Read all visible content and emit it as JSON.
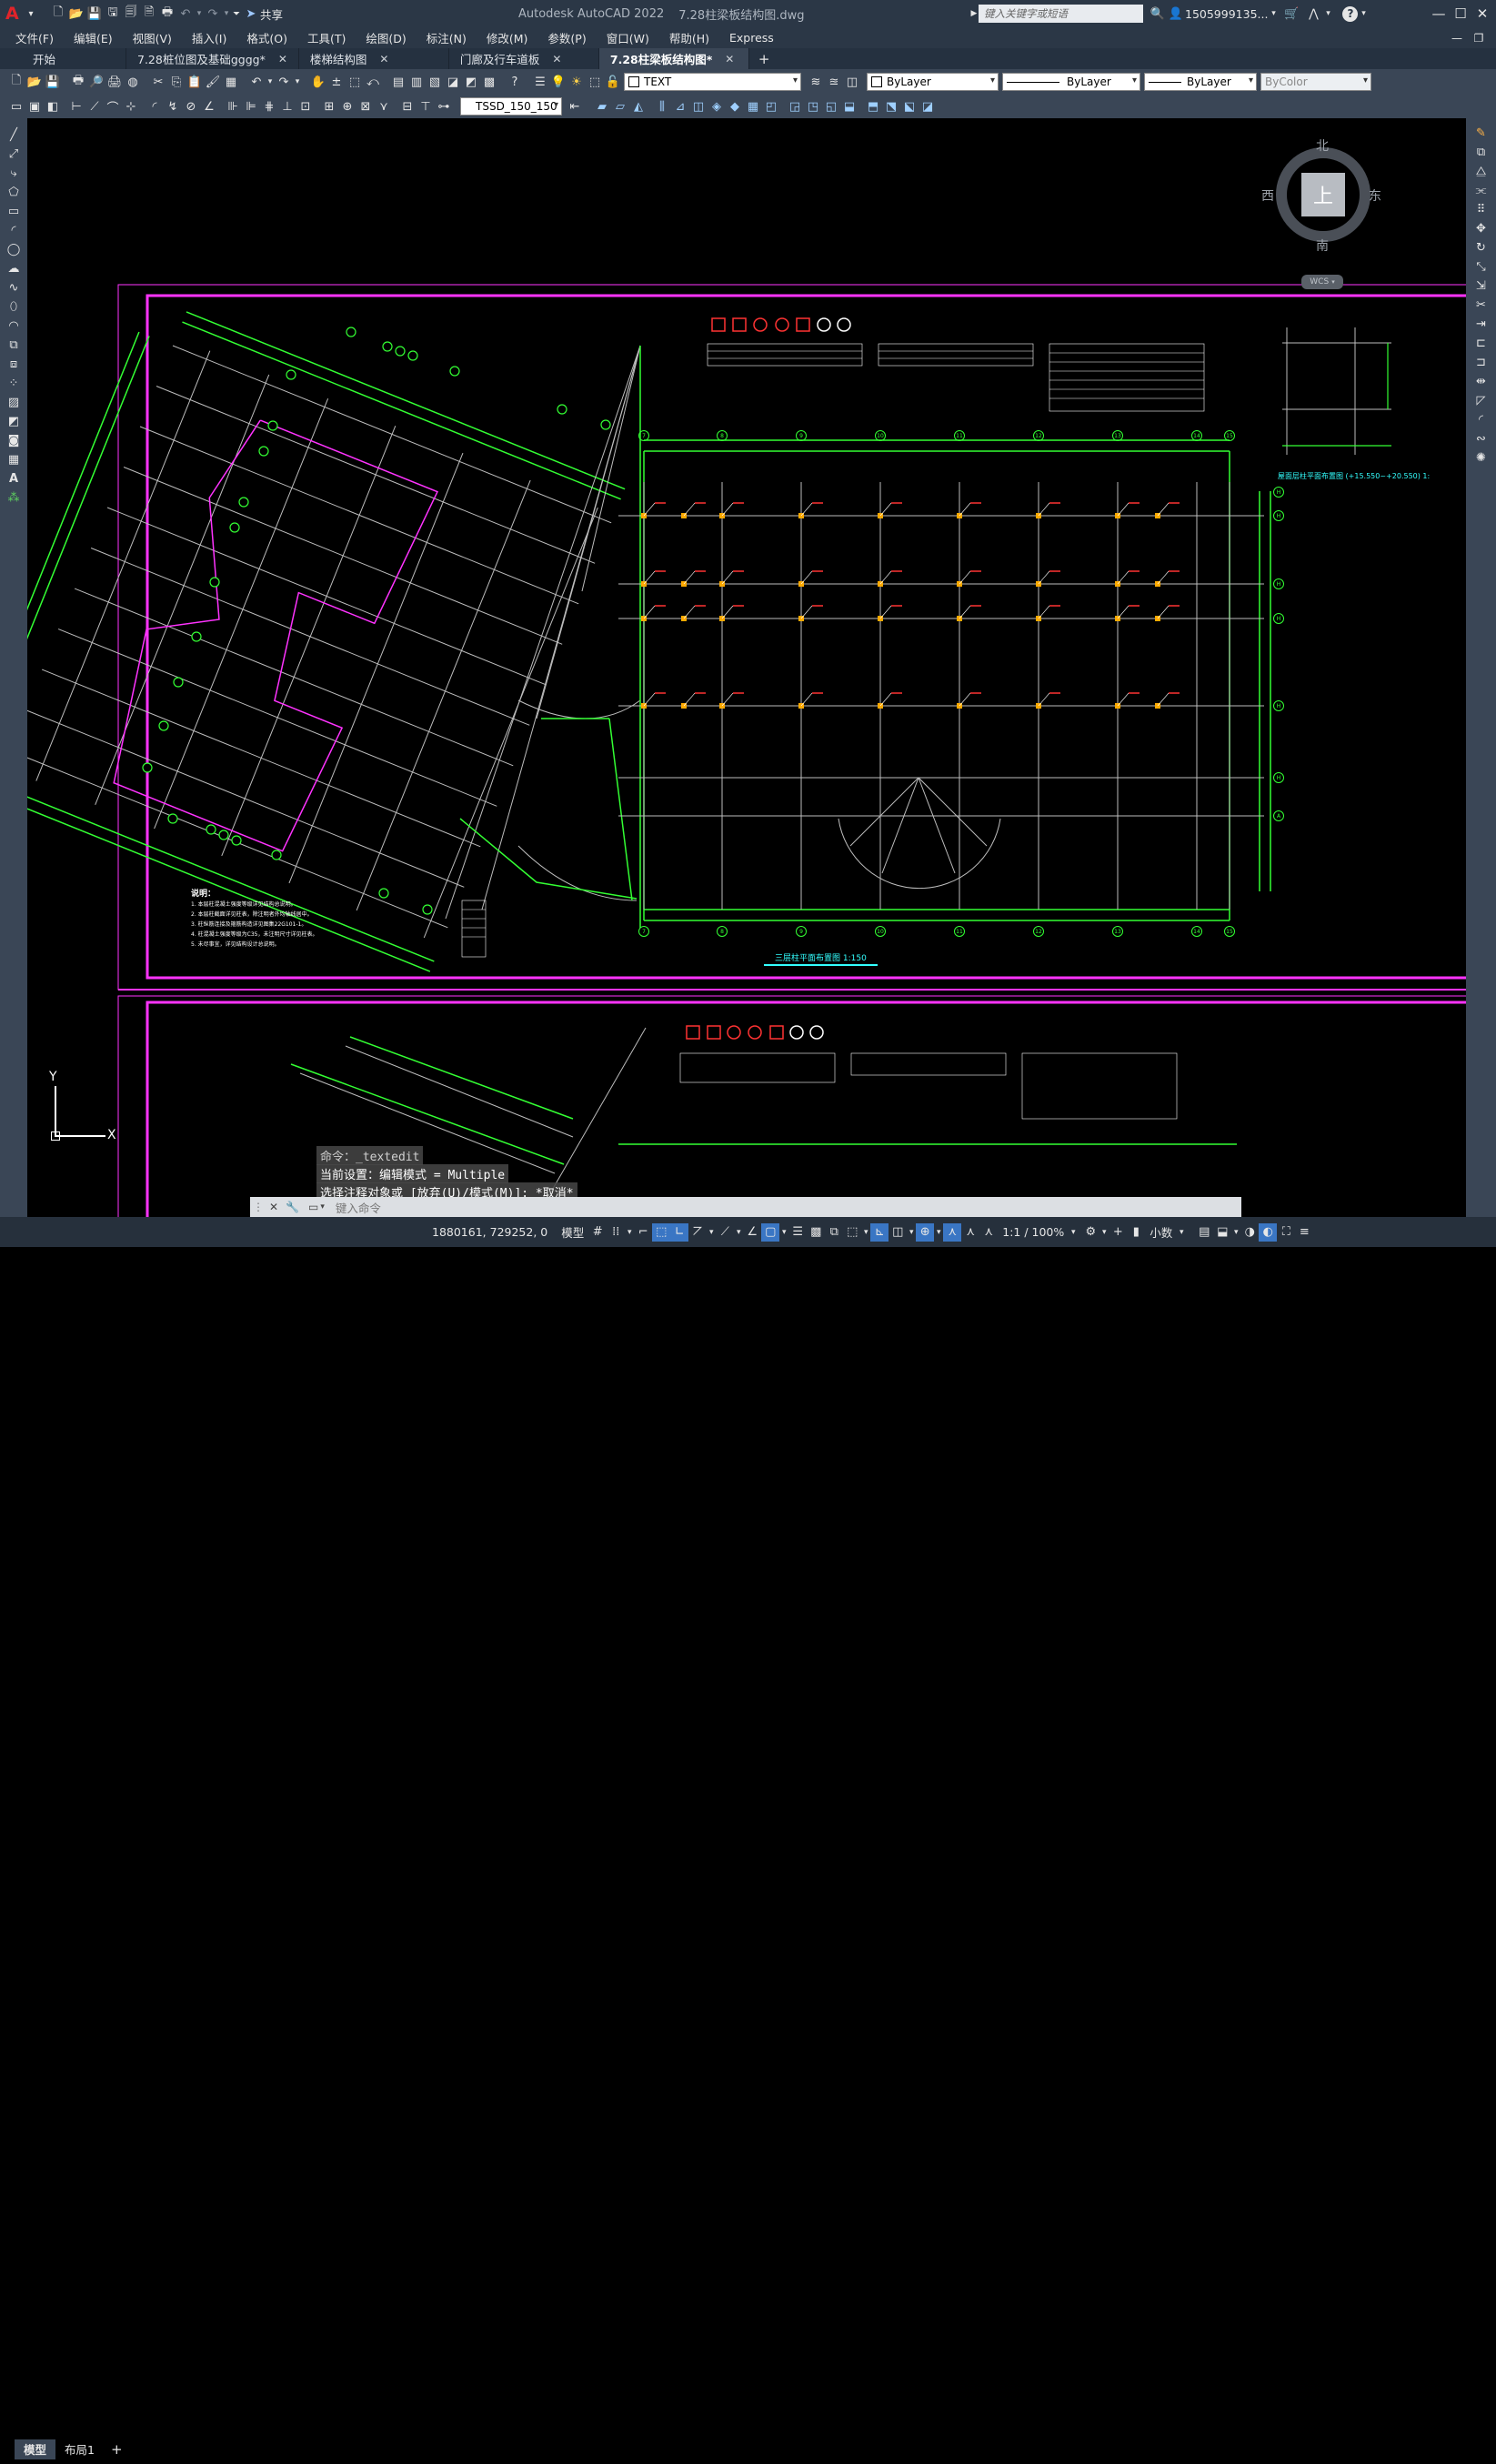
{
  "app": {
    "logo": "A",
    "title": "Autodesk AutoCAD 2022",
    "filename": "7.28柱梁板结构图.dwg",
    "share_label": "共享",
    "search_placeholder": "键入关键字或短语",
    "user": "1505999135...",
    "help": "?"
  },
  "menu": [
    "文件(F)",
    "编辑(E)",
    "视图(V)",
    "插入(I)",
    "格式(O)",
    "工具(T)",
    "绘图(D)",
    "标注(N)",
    "修改(M)",
    "参数(P)",
    "窗口(W)",
    "帮助(H)",
    "Express"
  ],
  "tabs": [
    {
      "label": "开始",
      "close": false,
      "active": false
    },
    {
      "label": "7.28桩位图及基础gggg*",
      "close": true,
      "active": false
    },
    {
      "label": "楼梯结构图",
      "close": true,
      "active": false
    },
    {
      "label": "门廊及行车道板",
      "close": true,
      "active": false
    },
    {
      "label": "7.28柱梁板结构图*",
      "close": true,
      "active": true
    }
  ],
  "toolbar": {
    "layer_name": "TEXT",
    "color": "ByLayer",
    "linetype": "ByLayer",
    "lineweight": "ByLayer",
    "plotstyle": "ByColor",
    "textstyle": "TSSD_150_150"
  },
  "viewcube": {
    "north": "北",
    "south": "南",
    "east": "东",
    "west": "西",
    "top": "上",
    "wcs": "WCS"
  },
  "drawing": {
    "plan_title": "三层柱平面布置图  1:150",
    "right_title": "屋面层柱平面布置图 (+15.550~+20.550) 1:",
    "notes_title": "说明：",
    "notes": [
      "1. 本层柱混凝土强度等级详见结构总说明。",
      "2. 本层柱截面详见柱表，除注明者外均轴线居中。",
      "3. 柱纵筋连接及箍筋构造详见图集22G101-1。",
      "4. 柱混凝土强度等级为C35，未注明尺寸详见柱表。",
      "5. 未尽事宜，详见结构设计总说明。"
    ],
    "axes_top": [
      "7",
      "8",
      "9",
      "10",
      "11",
      "12",
      "13",
      "14",
      "15"
    ],
    "axes_right": [
      "H",
      "H",
      "H",
      "H",
      "H",
      "H",
      "A"
    ],
    "axis_color": "#33ff33",
    "frame_color": "#ff33ff",
    "grid_color": "#bdbdbd"
  },
  "command": {
    "line1": "命令：_textedit",
    "line2": "当前设置：编辑模式 = Multiple",
    "line3": "选择注释对象或 [放弃(U)/模式(M)]: *取消*",
    "placeholder": "键入命令"
  },
  "ucs": {
    "x": "X",
    "y": "Y"
  },
  "layout_tabs": [
    {
      "label": "模型",
      "active": true
    },
    {
      "label": "布局1",
      "active": false
    }
  ],
  "status": {
    "coords": "1880161, 729252, 0",
    "space": "模型",
    "scale": "1:1 / 100%",
    "units": "小数"
  }
}
